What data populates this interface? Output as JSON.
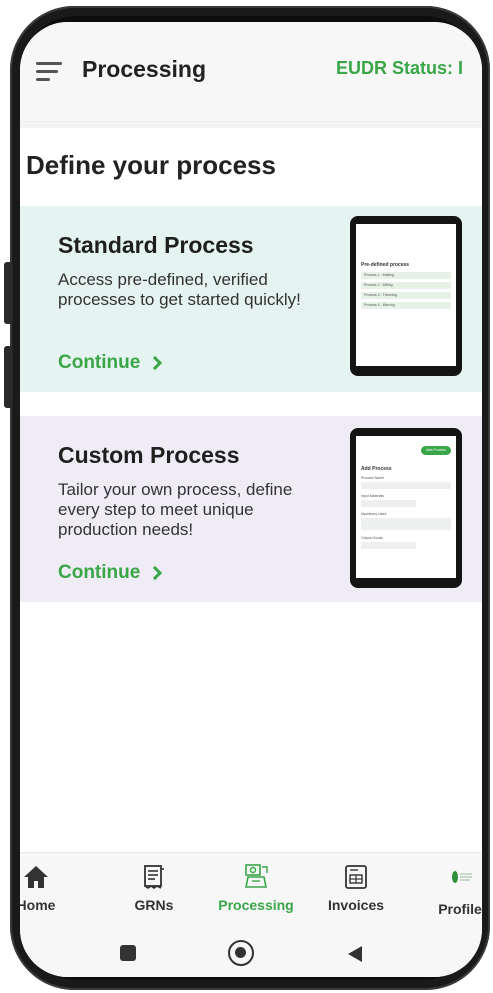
{
  "appbar": {
    "title": "Processing",
    "eudr_status_label": "EUDR Status: I"
  },
  "section": {
    "title": "Define your process"
  },
  "cards": {
    "standard": {
      "title": "Standard Process",
      "description": "Access pre-defined, verified processes to get started quickly!",
      "link": "Continue",
      "mockup": {
        "heading": "Pre-defined process",
        "rows": [
          "Process 1 - Malting",
          "Process 2 - Milling",
          "Process 3 - Trimming",
          "Process 4 - Mincing"
        ]
      }
    },
    "custom": {
      "title": "Custom Process",
      "description": "Tailor your own process, define every step to meet unique production needs!",
      "link": "Continue",
      "mockup": {
        "button": "Add Process",
        "heading": "Add Process",
        "fields": [
          "Process Name",
          "Input Materials",
          "Machinery Used",
          "Output Goods"
        ]
      }
    }
  },
  "bottom_nav": {
    "items": [
      {
        "label": "Home",
        "icon": "home-icon"
      },
      {
        "label": "GRNs",
        "icon": "receipt-icon"
      },
      {
        "label": "Processing",
        "icon": "processing-icon",
        "active": true
      },
      {
        "label": "Invoices",
        "icon": "invoice-icon"
      },
      {
        "label": "Profile",
        "icon": "profile-logo-icon"
      }
    ]
  },
  "colors": {
    "accent": "#3aa648",
    "standard_card_bg": "#e5f3f1",
    "custom_card_bg": "#efecf5",
    "appbar_bg": "#f6f7f6"
  }
}
